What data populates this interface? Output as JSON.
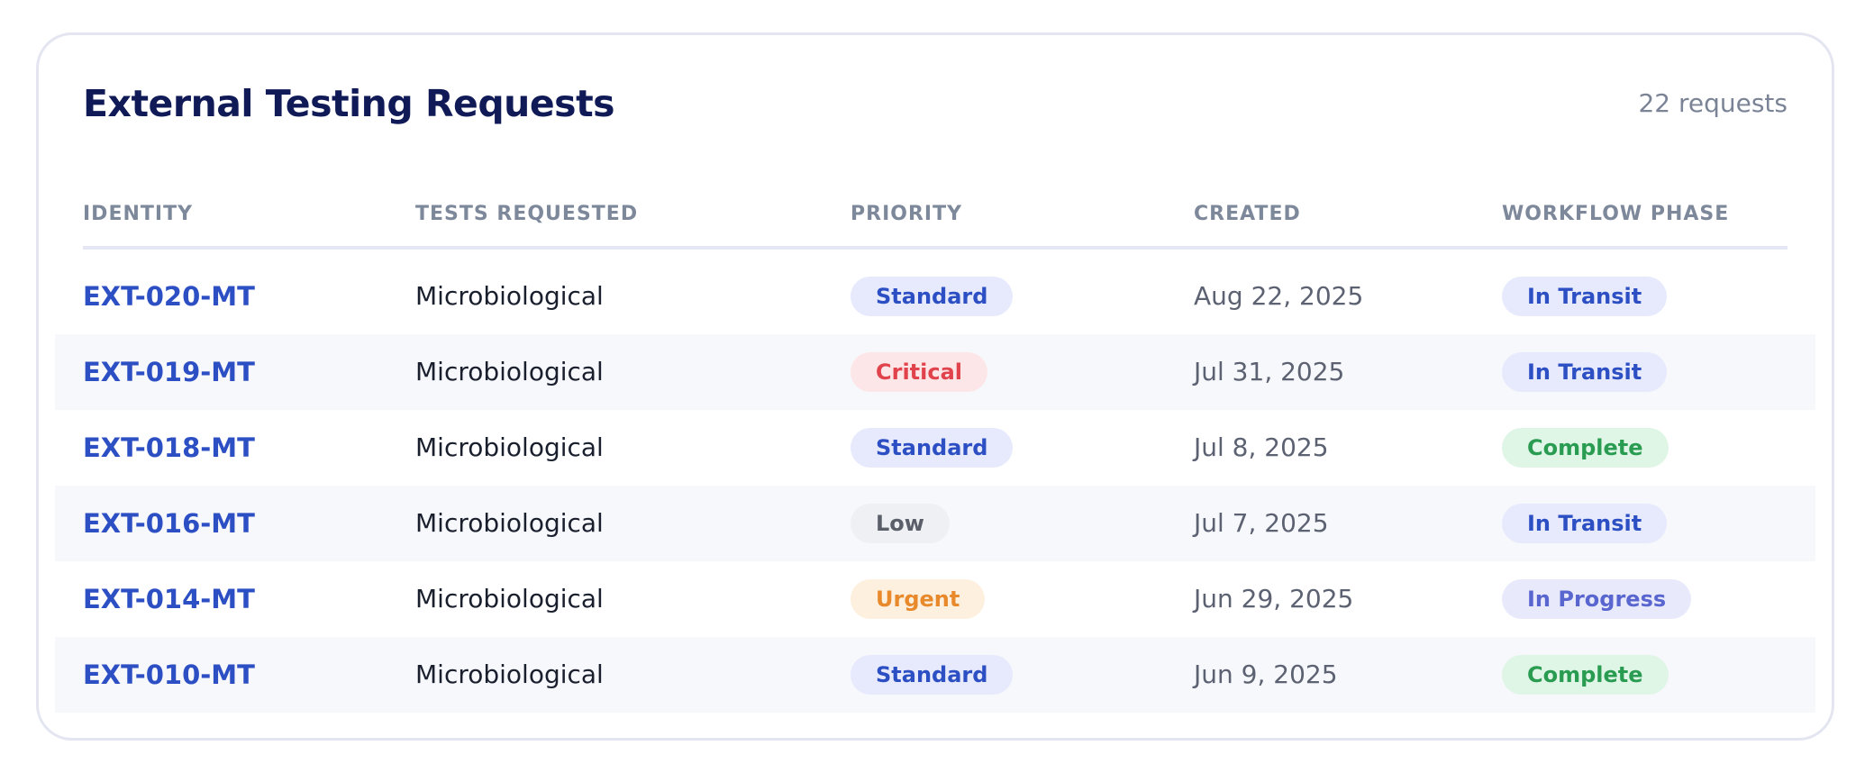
{
  "header": {
    "title": "External Testing Requests",
    "count": "22 requests"
  },
  "columns": {
    "identity": "IDENTITY",
    "tests": "TESTS REQUESTED",
    "priority": "PRIORITY",
    "created": "CREATED",
    "phase": "WORKFLOW PHASE"
  },
  "colors": {
    "standard": {
      "bg": "#e6eafc",
      "fg": "#2d4fc4"
    },
    "critical": {
      "bg": "#fde6e8",
      "fg": "#e0434b"
    },
    "low": {
      "bg": "#eef0f3",
      "fg": "#5a5f69"
    },
    "urgent": {
      "bg": "#fdf0de",
      "fg": "#e8892c"
    },
    "in_transit": {
      "bg": "#e6eafc",
      "fg": "#2d4fc4"
    },
    "complete": {
      "bg": "#dff5e6",
      "fg": "#2a9c52"
    },
    "in_progress": {
      "bg": "#e8eafb",
      "fg": "#5a66d0"
    }
  },
  "rows": [
    {
      "identity": "EXT-020-MT",
      "tests": "Microbiological",
      "priority": "Standard",
      "priority_key": "standard",
      "created": "Aug 22, 2025",
      "phase": "In Transit",
      "phase_key": "in_transit"
    },
    {
      "identity": "EXT-019-MT",
      "tests": "Microbiological",
      "priority": "Critical",
      "priority_key": "critical",
      "created": "Jul 31, 2025",
      "phase": "In Transit",
      "phase_key": "in_transit"
    },
    {
      "identity": "EXT-018-MT",
      "tests": "Microbiological",
      "priority": "Standard",
      "priority_key": "standard",
      "created": "Jul 8, 2025",
      "phase": "Complete",
      "phase_key": "complete"
    },
    {
      "identity": "EXT-016-MT",
      "tests": "Microbiological",
      "priority": "Low",
      "priority_key": "low",
      "created": "Jul 7, 2025",
      "phase": "In Transit",
      "phase_key": "in_transit"
    },
    {
      "identity": "EXT-014-MT",
      "tests": "Microbiological",
      "priority": "Urgent",
      "priority_key": "urgent",
      "created": "Jun 29, 2025",
      "phase": "In Progress",
      "phase_key": "in_progress"
    },
    {
      "identity": "EXT-010-MT",
      "tests": "Microbiological",
      "priority": "Standard",
      "priority_key": "standard",
      "created": "Jun 9, 2025",
      "phase": "Complete",
      "phase_key": "complete"
    }
  ]
}
